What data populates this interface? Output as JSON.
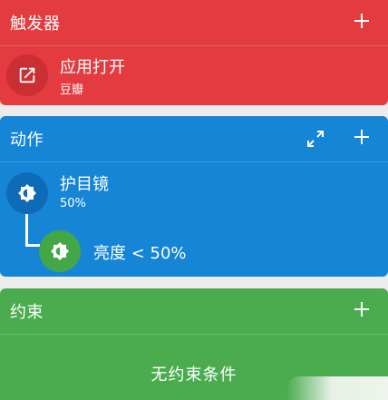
{
  "trigger": {
    "title": "触发器",
    "item": {
      "label": "应用打开",
      "sublabel": "豆瓣",
      "icon": "open-external-icon"
    }
  },
  "action": {
    "title": "动作",
    "items": [
      {
        "label": "护目镜",
        "sublabel": "50%",
        "icon": "brightness-icon"
      },
      {
        "label": "亮度 < 50%",
        "icon": "brightness-icon"
      }
    ]
  },
  "constraint": {
    "title": "约束",
    "empty_text": "无约束条件"
  },
  "colors": {
    "trigger": "#e33b3f",
    "action": "#1685d6",
    "constraint": "#4aac4f"
  }
}
